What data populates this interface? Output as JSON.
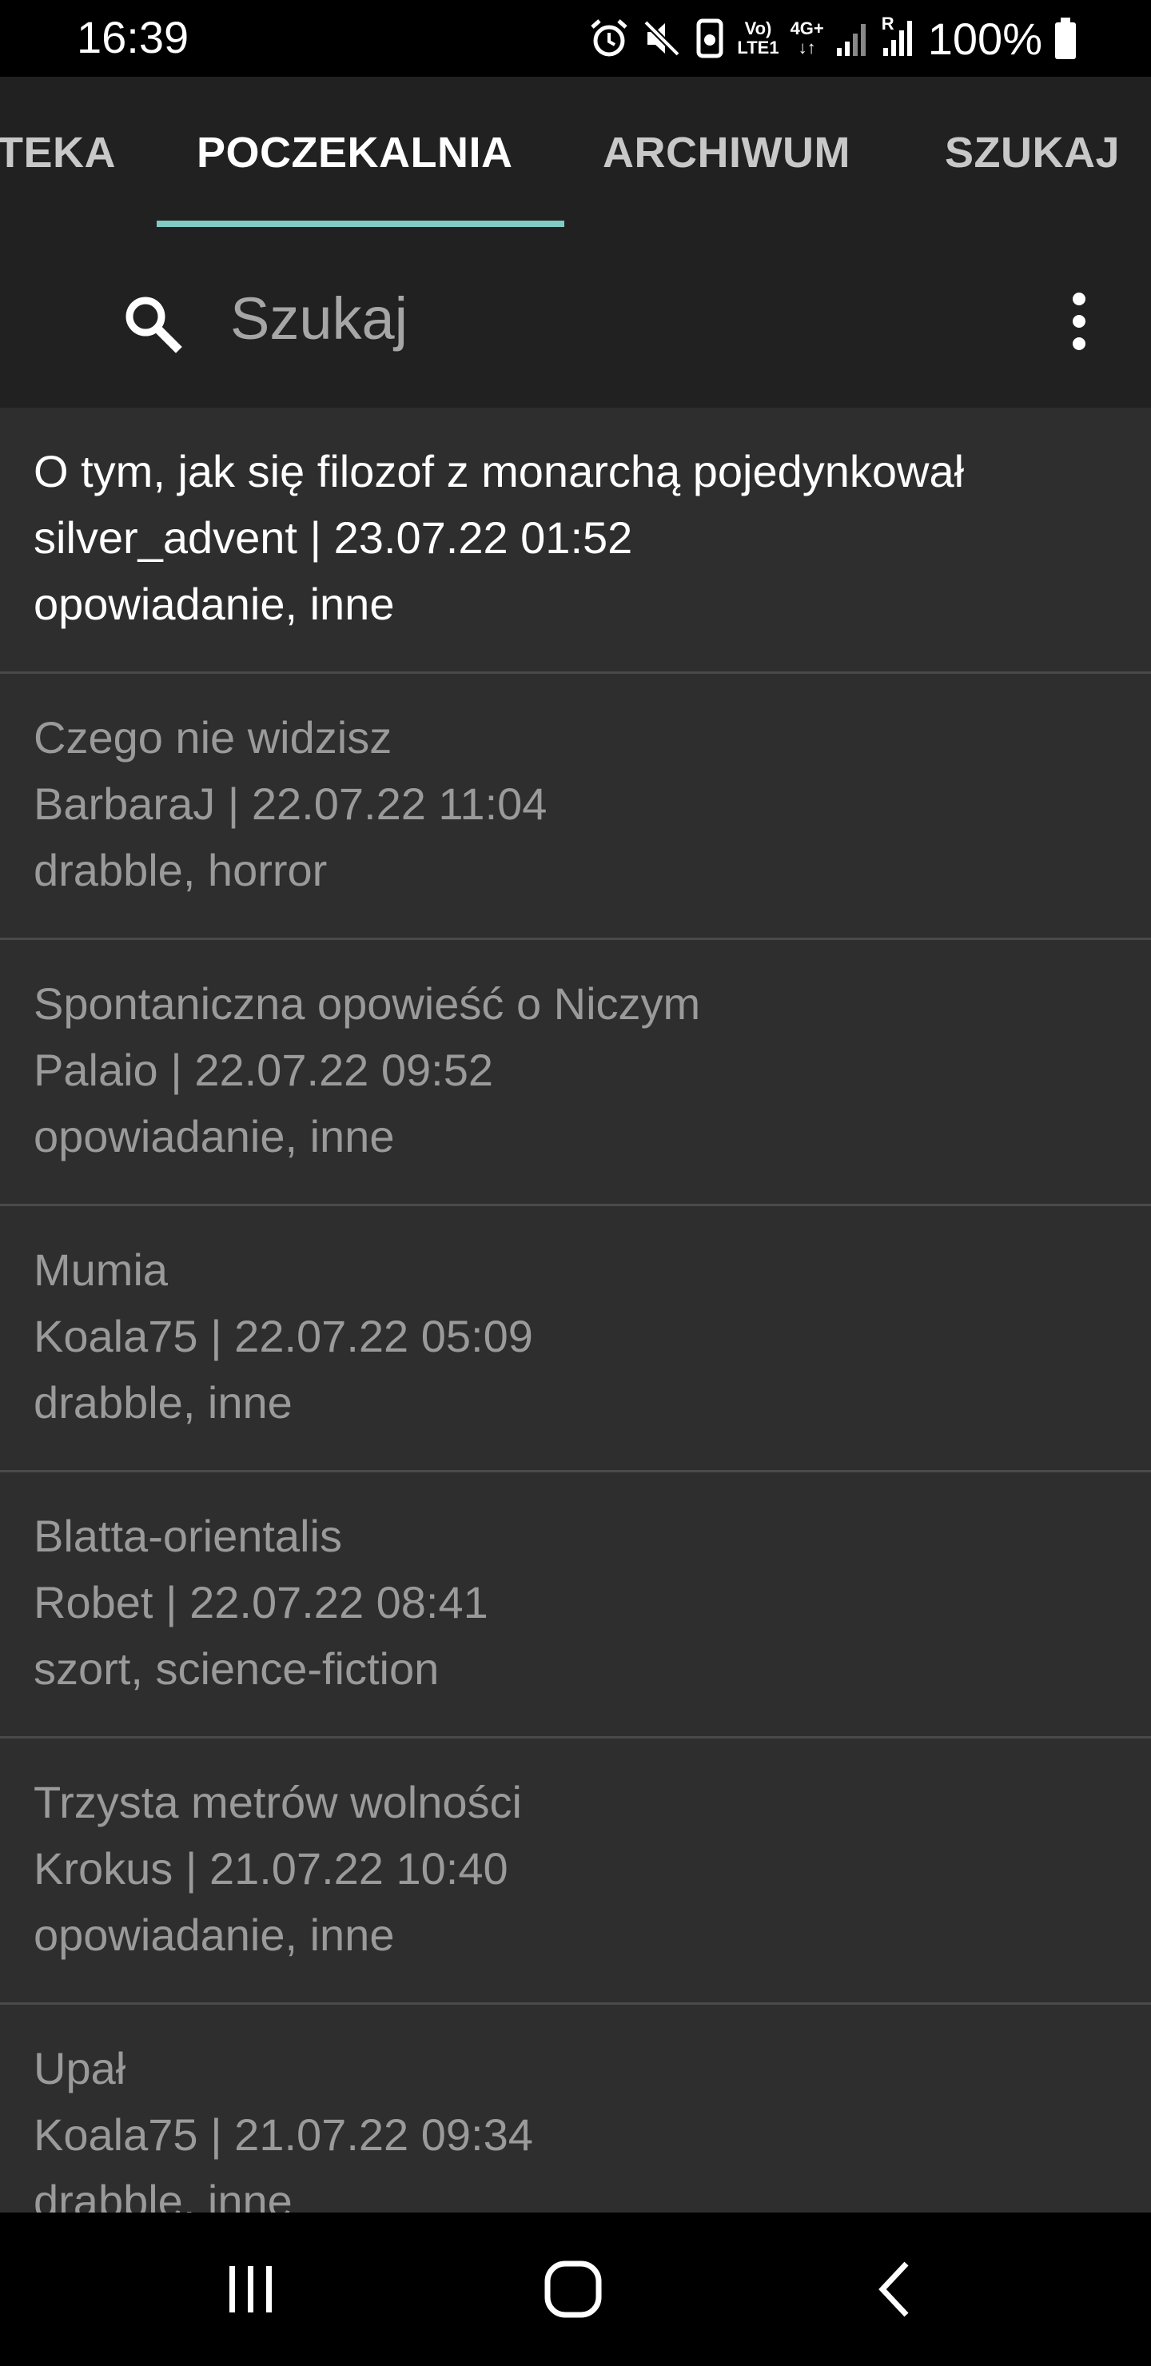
{
  "status_bar": {
    "time": "16:39",
    "network_top": "Vo)",
    "network_bottom": "LTE1",
    "network_type": "4G+",
    "roaming": "R",
    "battery": "100%"
  },
  "tabs": [
    {
      "label": "TEKA",
      "active": false
    },
    {
      "label": "POCZEKALNIA",
      "active": true
    },
    {
      "label": "ARCHIWUM",
      "active": false
    },
    {
      "label": "SZUKAJ",
      "active": false
    }
  ],
  "colors": {
    "accent": "#80cbc4",
    "background": "#2e2e2e",
    "toolbar": "#212121",
    "read_text": "#9a9a9a",
    "unread_text": "#ffffff"
  },
  "search": {
    "placeholder": "Szukaj",
    "value": "",
    "icon": "search-icon"
  },
  "menu_icon": "more-vert-icon",
  "stories": [
    {
      "title": "O tym, jak się filozof z monarchą pojedynkował",
      "meta": "silver_advent | 23.07.22 01:52",
      "tags": "opowiadanie, inne",
      "unread": true
    },
    {
      "title": "Czego nie widzisz",
      "meta": "BarbaraJ | 22.07.22 11:04",
      "tags": "drabble, horror",
      "unread": false
    },
    {
      "title": "Spontaniczna opowieść o Niczym",
      "meta": "Palaio | 22.07.22 09:52",
      "tags": "opowiadanie, inne",
      "unread": false
    },
    {
      "title": "Mumia",
      "meta": "Koala75 | 22.07.22 05:09",
      "tags": "drabble, inne",
      "unread": false
    },
    {
      "title": "Blatta-orientalis",
      "meta": "Robet | 22.07.22 08:41",
      "tags": "szort, science-fiction",
      "unread": false
    },
    {
      "title": "Trzysta metrów wolności",
      "meta": "Krokus | 21.07.22 10:40",
      "tags": "opowiadanie, inne",
      "unread": false
    },
    {
      "title": "Upał",
      "meta": "Koala75 | 21.07.22 09:34",
      "tags": "drabble, inne",
      "unread": false
    }
  ],
  "nav_bar": {
    "recents": "recents-icon",
    "home": "home-icon",
    "back": "back-icon"
  }
}
